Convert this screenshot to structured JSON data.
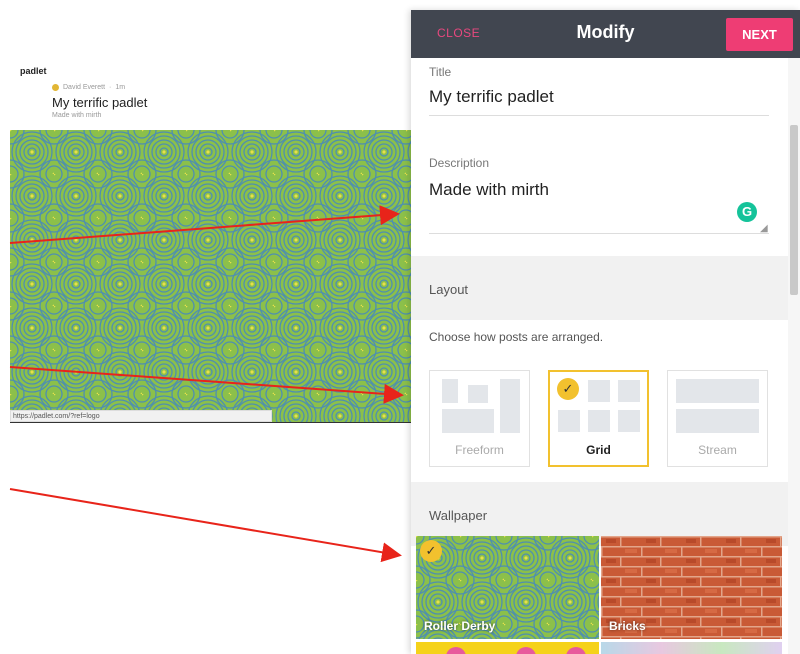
{
  "preview": {
    "brand": "padlet",
    "author": "David Everett",
    "time": "1m",
    "separator": "·",
    "title": "My terrific padlet",
    "description": "Made with mirth",
    "status_url": "https://padlet.com/?ref=logo"
  },
  "panel": {
    "close_label": "CLOSE",
    "title": "Modify",
    "next_label": "NEXT",
    "title_field": {
      "label": "Title",
      "value": "My terrific padlet"
    },
    "description_field": {
      "label": "Description",
      "value": "Made with mirth"
    },
    "grammarly_icon": "G",
    "layout": {
      "heading": "Layout",
      "help": "Choose how posts are arranged.",
      "options": [
        {
          "label": "Freeform",
          "selected": false
        },
        {
          "label": "Grid",
          "selected": true
        },
        {
          "label": "Stream",
          "selected": false
        }
      ]
    },
    "wallpaper": {
      "heading": "Wallpaper",
      "options": [
        {
          "label": "Roller Derby",
          "selected": true
        },
        {
          "label": "Bricks",
          "selected": false
        }
      ]
    }
  },
  "colors": {
    "topbar": "#414650",
    "accent_pink": "#ee3d74",
    "select_yellow": "#f2c12e",
    "arrow_red": "#e8241a",
    "wall_green": "#8cc04a",
    "wall_blue": "#4e8fb0"
  },
  "icons": [
    "checkmark-icon",
    "grammarly-icon",
    "resize-handle-icon",
    "arrow-annotation"
  ]
}
